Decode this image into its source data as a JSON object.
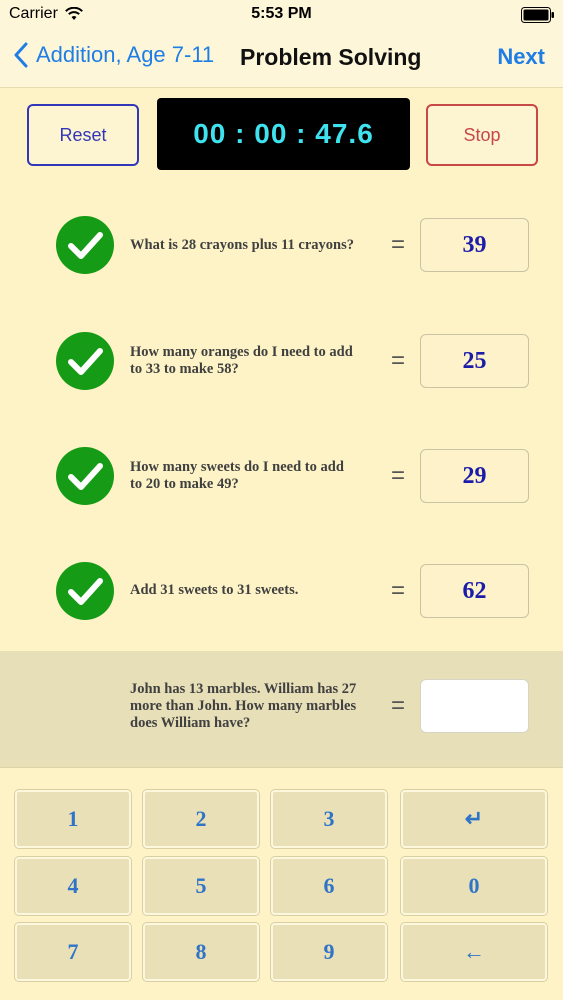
{
  "status_bar": {
    "carrier": "Carrier",
    "time": "5:53 PM"
  },
  "nav": {
    "back_label": "Addition, Age 7-11",
    "title": "Problem Solving",
    "next_label": "Next"
  },
  "controls": {
    "reset_label": "Reset",
    "timer": "00 : 00 : 47.6",
    "stop_label": "Stop"
  },
  "questions": [
    {
      "line1": "What is 28 crayons plus 11 crayons?",
      "line2": "",
      "line3": "",
      "equals": "=",
      "answer": "39",
      "status": "correct"
    },
    {
      "line1": "How many oranges do I need to add",
      "line2": "to 33 to make 58?",
      "line3": "",
      "equals": "=",
      "answer": "25",
      "status": "correct"
    },
    {
      "line1": "How many sweets do I need to add",
      "line2": "to 20 to make 49?",
      "line3": "",
      "equals": "=",
      "answer": "29",
      "status": "correct"
    },
    {
      "line1": "Add 31 sweets to 31 sweets.",
      "line2": "",
      "line3": "",
      "equals": "=",
      "answer": "62",
      "status": "correct"
    },
    {
      "line1": "John has 13 marbles.  William has 27",
      "line2": "more than John.  How many marbles",
      "line3": "does William have?",
      "equals": "=",
      "answer": "",
      "status": "active"
    }
  ],
  "keypad": {
    "keys": [
      "1",
      "2",
      "3",
      "↵",
      "4",
      "5",
      "6",
      "0",
      "7",
      "8",
      "9",
      "←"
    ]
  },
  "colors": {
    "accent": "#1f7ee6",
    "check_green": "#169b16",
    "background": "#fdf3c6",
    "timer_text": "#3fe2ef"
  },
  "icons": {
    "back": "chevron-left-icon",
    "check": "checkmark-circle-icon",
    "wifi": "wifi-icon",
    "battery": "battery-icon"
  }
}
